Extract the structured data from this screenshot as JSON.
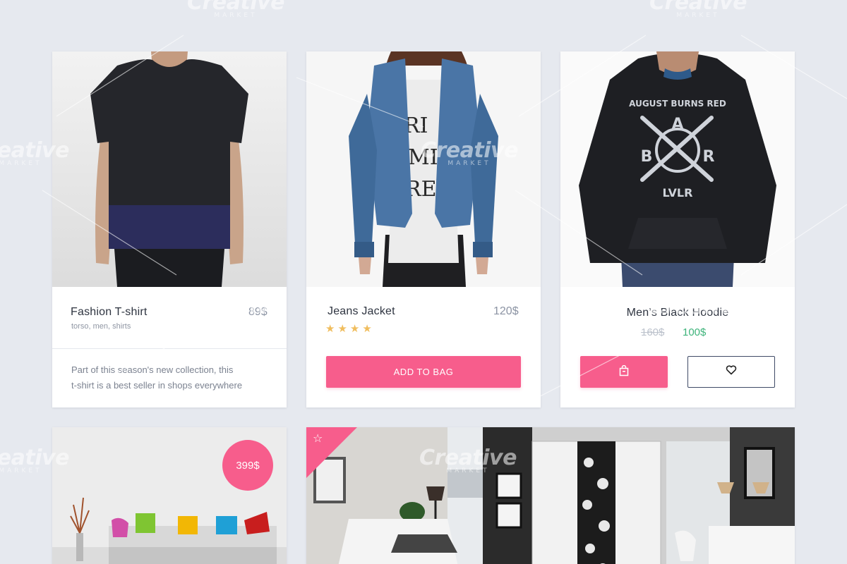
{
  "watermark": {
    "brand": "Creative",
    "sub": "MARKET"
  },
  "cards": {
    "tshirt": {
      "title": "Fashion T-shirt",
      "price": "89$",
      "tags": "torso, men, shirts",
      "description_line1": "Part of this season's new collection, this",
      "description_line2": "t-shirt is a best seller in shops everywhere",
      "image": "man-black-tshirt-photo"
    },
    "jacket": {
      "title": "Jeans Jacket",
      "price": "120$",
      "rating_stars": "★★★★",
      "rating": 4,
      "button_label": "ADD TO BAG",
      "image": "woman-denim-jacket-photo"
    },
    "hoodie": {
      "title": "Men’s Black Hoodie",
      "old_price": "160$",
      "new_price": "100$",
      "bag_icon": "shopping-bag-icon",
      "heart_icon": "heart-icon",
      "image": "man-black-hoodie-photo",
      "print_line1": "AUGUST BURNS RED",
      "print_a": "A",
      "print_b": "B",
      "print_r": "R",
      "print_lvlr": "LVLR"
    },
    "sofa": {
      "price_badge": "399$",
      "image": "white-sofa-colorful-pillows-photo"
    },
    "bedroom": {
      "image": "modern-bedroom-interior-photo",
      "star_icon": "star-icon"
    }
  },
  "colors": {
    "accent_pink": "#f75d8c",
    "sale_green": "#3db37a",
    "star_gold": "#f0bd5d",
    "background": "#e6e9ef"
  }
}
